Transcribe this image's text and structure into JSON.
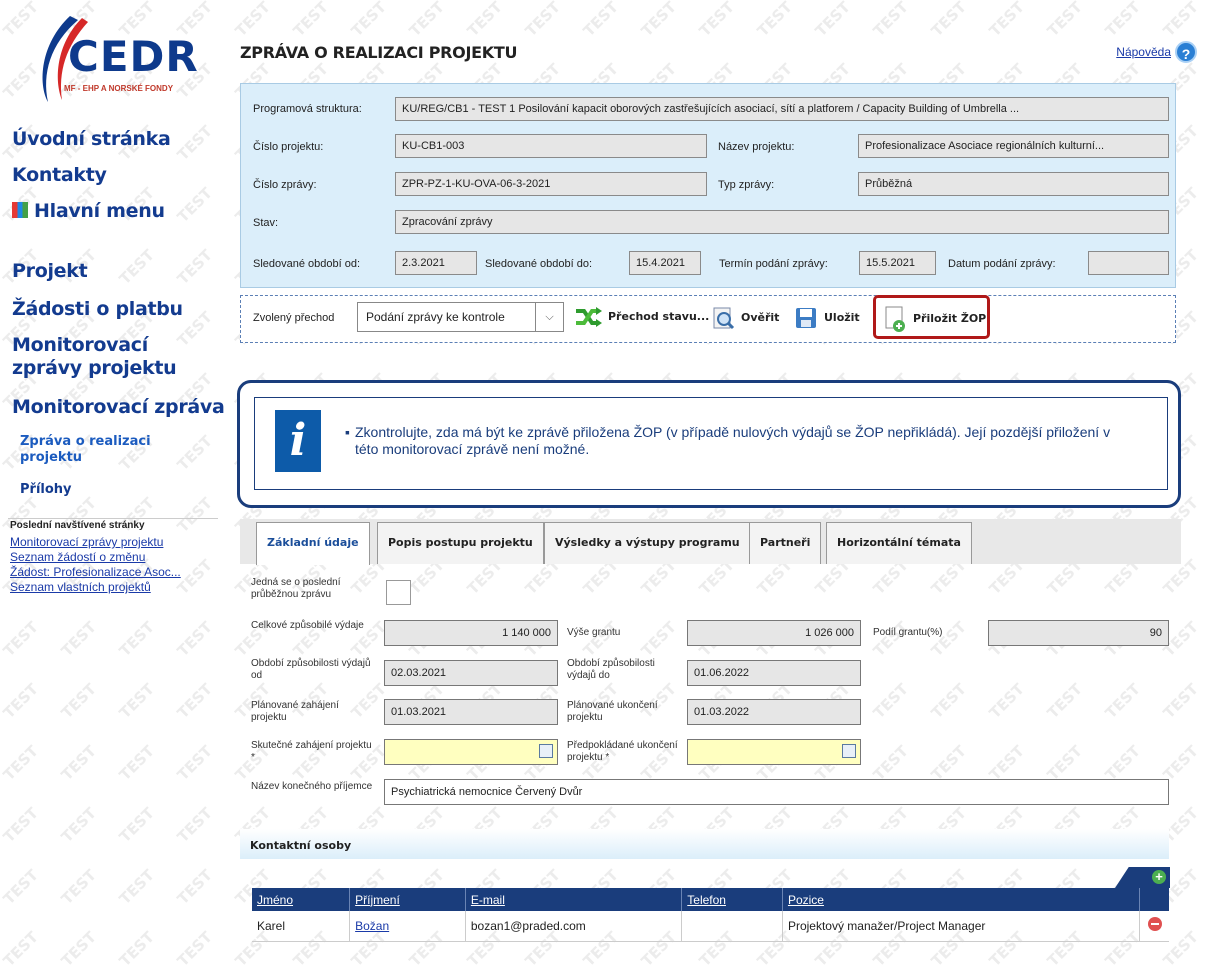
{
  "logo": {
    "name": "CEDR",
    "subtitle": "MF - EHP A NORSKÉ FONDY"
  },
  "watermark": "TEST",
  "sidebar": {
    "nav": [
      {
        "label": "Úvodní stránka"
      },
      {
        "label": "Kontakty"
      },
      {
        "label": "Hlavní menu"
      },
      {
        "label": "Projekt"
      },
      {
        "label": "Žádosti o platbu"
      },
      {
        "label": "Monitorovací zprávy projektu"
      },
      {
        "label": "Monitorovací zpráva"
      }
    ],
    "sub": [
      {
        "label": "Zpráva o realizaci projektu"
      },
      {
        "label": "Přílohy"
      }
    ],
    "recent_title": "Poslední navštívené stránky",
    "recent": [
      "Monitorovací zprávy projektu",
      "Seznam žádostí o změnu",
      "Žádost: Profesionalizace Asoc...",
      "Seznam vlastních projektů"
    ]
  },
  "page": {
    "title": "ZPRÁVA O REALIZACI PROJEKTU",
    "help": "Nápověda"
  },
  "header": {
    "program_label": "Programová struktura:",
    "program_value": "KU/REG/CB1 - TEST 1 Posilování kapacit oborových zastřešujících asociací, sítí a platforem / Capacity Building of Umbrella ...",
    "project_no_label": "Číslo projektu:",
    "project_no": "KU-CB1-003",
    "project_name_label": "Název projektu:",
    "project_name": "Profesionalizace Asociace regionálních kulturní...",
    "report_no_label": "Číslo zprávy:",
    "report_no": "ZPR-PZ-1-KU-OVA-06-3-2021",
    "report_type_label": "Typ zprávy:",
    "report_type": "Průběžná",
    "state_label": "Stav:",
    "state": "Zpracování zprávy",
    "period_from_label": "Sledované období od:",
    "period_from": "2.3.2021",
    "period_to_label": "Sledované období do:",
    "period_to": "15.4.2021",
    "deadline_label": "Termín podání zprávy:",
    "deadline": "15.5.2021",
    "submitted_label": "Datum podání zprávy:",
    "submitted": ""
  },
  "toolbar": {
    "transition_label": "Zvolený přechod",
    "transition_value": "Podání zprávy ke kontrole",
    "transition_btn": "Přechod stavu...",
    "verify_btn": "Ověřit",
    "save_btn": "Uložit",
    "attach_btn": "Přiložit ŽOP"
  },
  "info": {
    "message": "Zkontrolujte, zda má být ke zprávě přiložena ŽOP (v případě nulových výdajů se ŽOP nepřikládá). Její pozdější přiložení v této monitorovací zprávě není možné."
  },
  "tabs": [
    "Základní údaje",
    "Popis postupu projektu",
    "Výsledky a výstupy programu",
    "Partneři",
    "Horizontální témata"
  ],
  "form": {
    "last_report_label": "Jedná se o poslední průběžnou zprávu",
    "total_costs_label": "Celkové způsobilé výdaje",
    "total_costs": "1 140 000",
    "grant_label": "Výše grantu",
    "grant": "1 026 000",
    "grant_share_label": "Podíl grantu(%)",
    "grant_share": "90",
    "elig_from_label": "Období způsobilosti výdajů od",
    "elig_from": "02.03.2021",
    "elig_to_label": "Období způsobilosti výdajů do",
    "elig_to": "01.06.2022",
    "plan_start_label": "Plánované zahájení projektu",
    "plan_start": "01.03.2021",
    "plan_end_label": "Plánované ukončení projektu",
    "plan_end": "01.03.2022",
    "real_start_label": "Skutečné zahájení projektu *",
    "real_start": "",
    "exp_end_label": "Předpokládané ukončení projektu *",
    "exp_end": "",
    "recipient_label": "Název konečného příjemce",
    "recipient": "Psychiatrická nemocnice Červený Dvůr"
  },
  "contacts": {
    "title": "Kontaktní osoby",
    "columns": [
      "Jméno",
      "Příjmení",
      "E-mail",
      "Telefon",
      "Pozice"
    ],
    "rows": [
      {
        "first": "Karel",
        "last": "Božan",
        "email": "bozan1@praded.com",
        "phone": "",
        "position": "Projektový manažer/Project Manager"
      }
    ]
  }
}
